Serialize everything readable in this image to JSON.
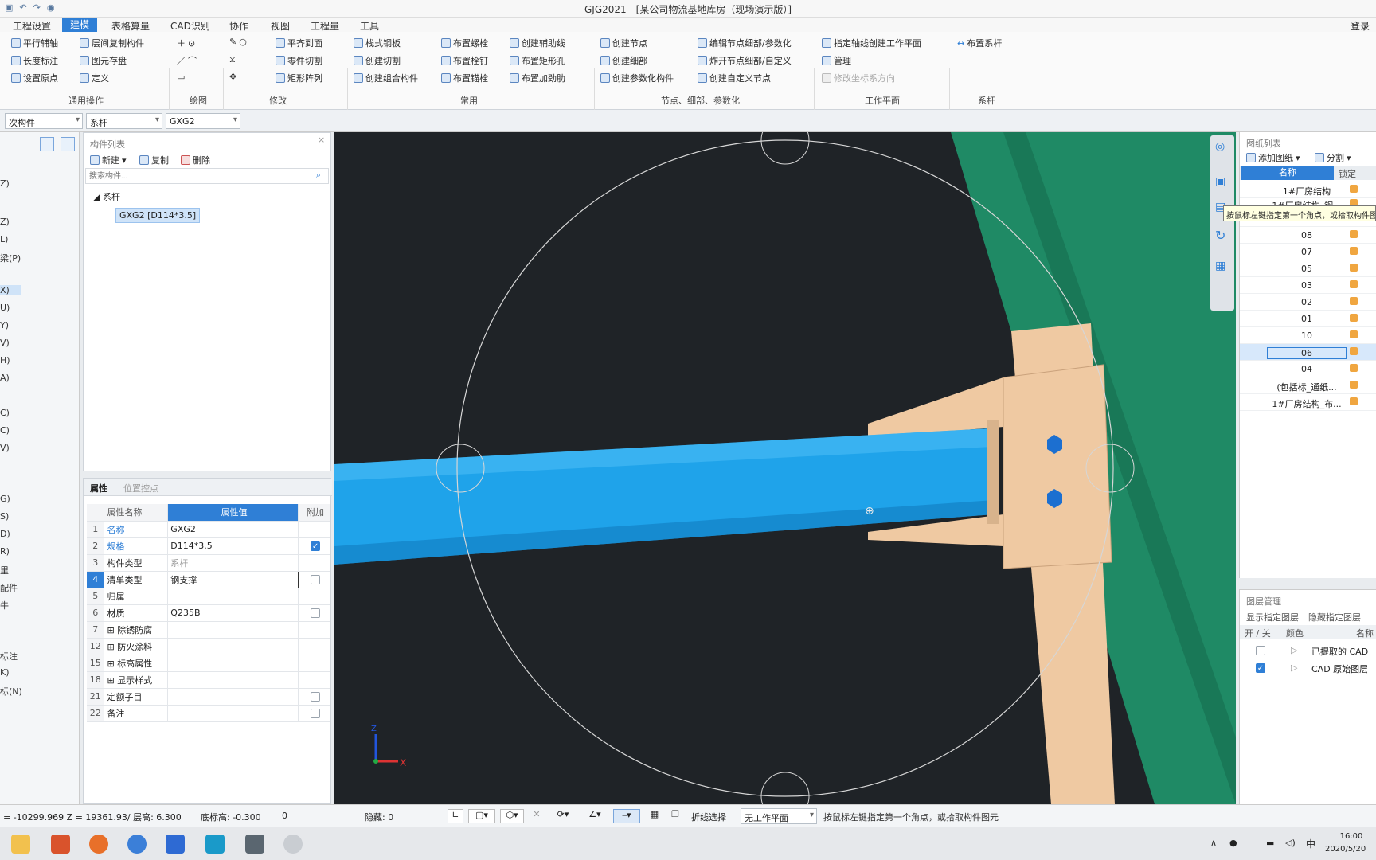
{
  "window": {
    "title": "GJG2021 - [某公司物流基地库房（现场演示版）]",
    "login": "登录"
  },
  "menu": [
    "工程设置",
    "建模",
    "表格算量",
    "CAD识别",
    "协作",
    "视图",
    "工程量",
    "工具"
  ],
  "active_menu_index": 1,
  "ribbon": {
    "general_ops": {
      "label": "通用操作",
      "items": [
        "平行辅轴",
        "层间复制构件",
        "长度标注",
        "图元存盘",
        "设置原点",
        "定义"
      ]
    },
    "draw": {
      "label": "绘图"
    },
    "modify": {
      "label": "修改",
      "items": [
        "平齐到面",
        "零件切割",
        "矩形阵列"
      ]
    },
    "common": {
      "label": "常用",
      "items": [
        "栈式钢板",
        "布置螺栓",
        "创建辅助线",
        "创建切割",
        "布置栓钉",
        "布置矩形孔",
        "创建组合构件",
        "布置锚栓",
        "布置加劲肋"
      ]
    },
    "nodes": {
      "label": "节点、细部、参数化",
      "items": [
        "创建节点",
        "编辑节点细部/参数化",
        "创建细部",
        "炸开节点细部/自定义",
        "创建参数化构件",
        "创建自定义节点"
      ]
    },
    "workplane": {
      "label": "工作平面",
      "items": [
        "指定轴线创建工作平面",
        "管理",
        "修改坐标系方向"
      ]
    },
    "tie": {
      "label": "系杆",
      "items": [
        "布置系杆"
      ]
    }
  },
  "selectors": {
    "floor": "次构件",
    "category": "系杆",
    "component": "GXG2"
  },
  "left_nav": [
    "Z)",
    "L)",
    "梁(P)",
    "X)",
    "U)",
    "Y)",
    "V)",
    "H)",
    "A)",
    "C)",
    "C)",
    "V)",
    "G)",
    "S)",
    "D)",
    "R)",
    "里",
    "配件",
    "牛",
    "标注",
    "K)",
    "标(N)"
  ],
  "component_list": {
    "title": "构件列表",
    "toolbar": {
      "new": "新建",
      "copy": "复制",
      "delete": "删除"
    },
    "search_placeholder": "搜索构件...",
    "tree_root": "系杆",
    "selected_item": "GXG2 [D114*3.5]"
  },
  "properties": {
    "tabs": [
      "属性",
      "位置控点"
    ],
    "headers": {
      "name": "属性名称",
      "value": "属性值",
      "extra": "附加"
    },
    "rows": [
      {
        "no": "1",
        "name": "名称",
        "value": "GXG2",
        "check": null
      },
      {
        "no": "2",
        "name": "规格",
        "value": "D114*3.5",
        "check": true
      },
      {
        "no": "3",
        "name": "构件类型",
        "value": "系杆",
        "check": null
      },
      {
        "no": "4",
        "name": "清单类型",
        "value": "钢支撑",
        "check": false
      },
      {
        "no": "5",
        "name": "归属",
        "value": "",
        "check": null
      },
      {
        "no": "6",
        "name": "材质",
        "value": "Q235B",
        "check": false
      },
      {
        "no": "7",
        "name": "除锈防腐",
        "value": "",
        "check": null
      },
      {
        "no": "12",
        "name": "防火涂料",
        "value": "",
        "check": null
      },
      {
        "no": "15",
        "name": "标高属性",
        "value": "",
        "check": null
      },
      {
        "no": "18",
        "name": "显示样式",
        "value": "",
        "check": null
      },
      {
        "no": "21",
        "name": "定额子目",
        "value": "",
        "check": false
      },
      {
        "no": "22",
        "name": "备注",
        "value": "",
        "check": false
      }
    ]
  },
  "drawings": {
    "title": "图纸列表",
    "toolbar": {
      "add": "添加图纸",
      "split": "分割"
    },
    "headers": {
      "name": "名称",
      "lock": "锁定"
    },
    "rows": [
      "1#厂房结构",
      "1#厂房结构_钢...",
      "09",
      "08",
      "07",
      "05",
      "03",
      "02",
      "01",
      "10",
      "06",
      "04",
      "(包括标_通纸...",
      "1#厂房结构_布..."
    ],
    "selected": "06",
    "tooltip": "按鼠标左键指定第一个角点，或拾取构件图元"
  },
  "layers": {
    "title": "图层管理",
    "actions": {
      "show": "显示指定图层",
      "hide": "隐藏指定图层"
    },
    "headers": {
      "onoff": "开 / 关",
      "color": "颜色",
      "name": "名称"
    },
    "rows": [
      {
        "name": "已提取的 CAD",
        "on": false
      },
      {
        "name": "CAD 原始图层",
        "on": true
      }
    ]
  },
  "viewport": {
    "axis_x": "X",
    "axis_z": "Z"
  },
  "status": {
    "coords": "= -10299.969 Z = 19361.93/ 层高: 6.300",
    "base_elev": "底标高: -0.300",
    "zero": "0",
    "hidden": "隐藏: 0",
    "polyline_select": "折线选择",
    "workplane": "无工作平面",
    "hint": "按鼠标左键指定第一个角点，或拾取构件图元"
  },
  "taskbar": {
    "time": "16:00",
    "date": "2020/5/20",
    "ime": "中"
  },
  "colors": {
    "accent": "#2f7fd6",
    "member": "#1fa3ea",
    "plate": "#efc9a2",
    "green": "#1f8a65",
    "viewport": "#1f2327"
  }
}
